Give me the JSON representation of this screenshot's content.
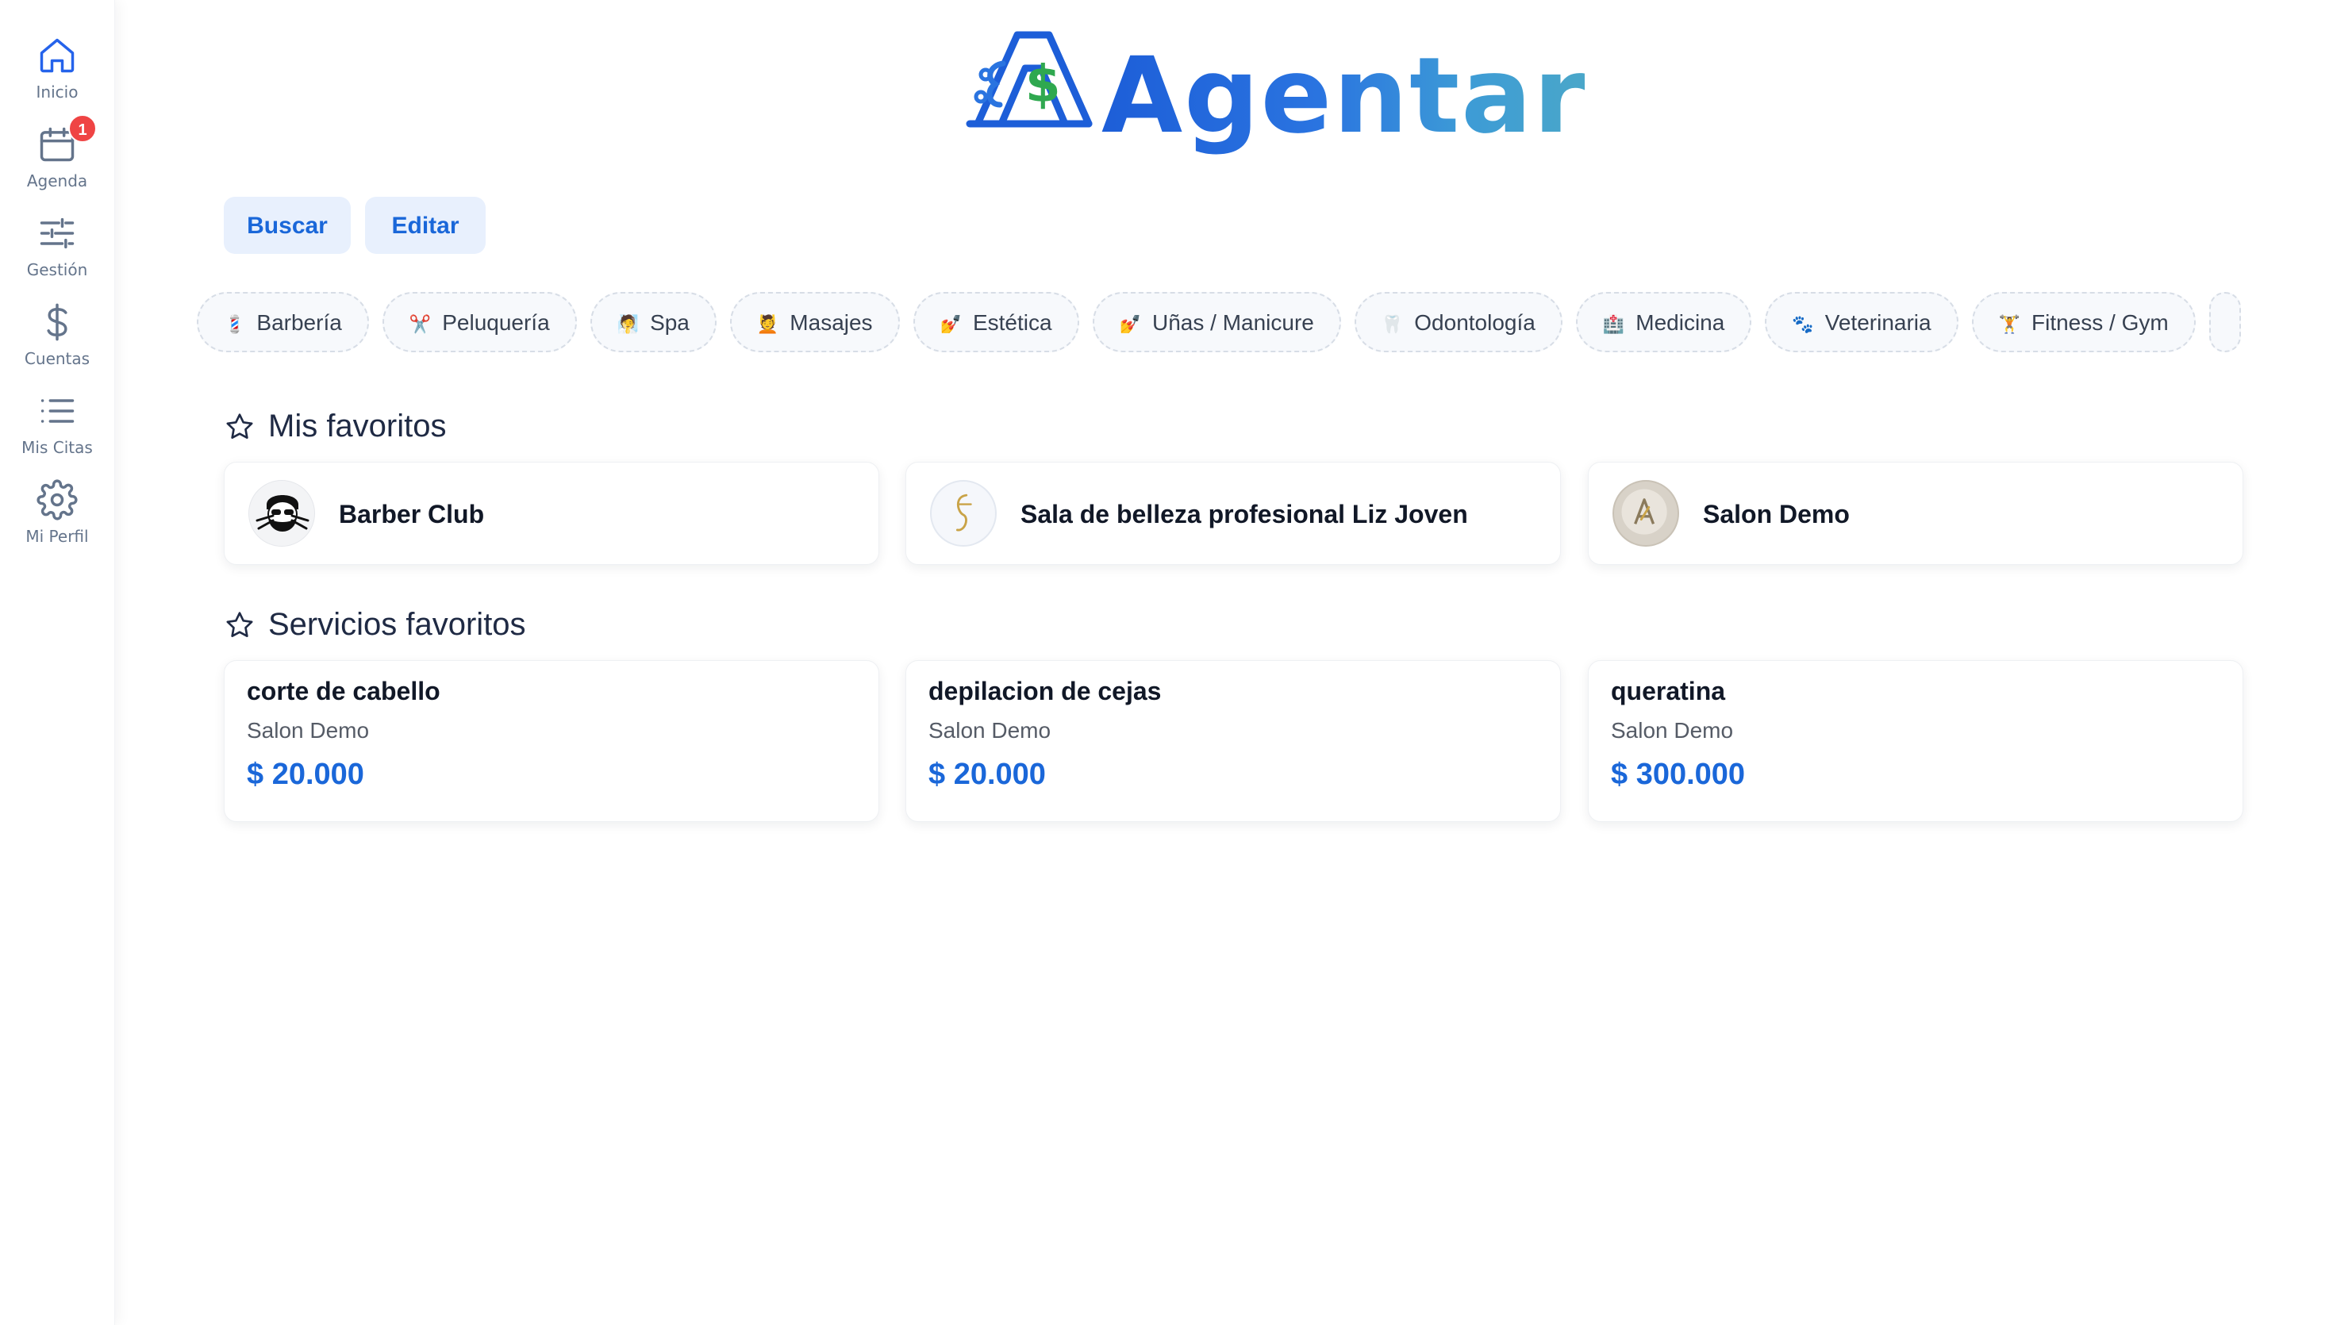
{
  "sidebar": {
    "items": [
      {
        "label": "Inicio",
        "icon": "home-icon"
      },
      {
        "label": "Agenda",
        "icon": "calendar-icon",
        "badge": "1"
      },
      {
        "label": "Gestión",
        "icon": "sliders-icon"
      },
      {
        "label": "Cuentas",
        "icon": "dollar-icon"
      },
      {
        "label": "Mis Citas",
        "icon": "list-icon"
      },
      {
        "label": "Mi Perfil",
        "icon": "gear-icon"
      }
    ],
    "active_color": "#2563eb",
    "icon_color": "#64748b"
  },
  "logo": {
    "text": "Agentar"
  },
  "actions": {
    "search_label": "Buscar",
    "edit_label": "Editar"
  },
  "categories": [
    {
      "emoji": "💈",
      "label": "Barbería"
    },
    {
      "emoji": "✂️",
      "label": "Peluquería"
    },
    {
      "emoji": "🧖",
      "label": "Spa"
    },
    {
      "emoji": "💆",
      "label": "Masajes"
    },
    {
      "emoji": "💅",
      "label": "Estética"
    },
    {
      "emoji": "💅",
      "label": "Uñas / Manicure"
    },
    {
      "emoji": "🦷",
      "label": "Odontología"
    },
    {
      "emoji": "🏥",
      "label": "Medicina"
    },
    {
      "emoji": "🐾",
      "label": "Veterinaria"
    },
    {
      "emoji": "🏋️",
      "label": "Fitness / Gym"
    }
  ],
  "favorites": {
    "title": "Mis favoritos",
    "items": [
      {
        "name": "Barber Club"
      },
      {
        "name": "Sala de belleza profesional Liz Joven"
      },
      {
        "name": "Salon Demo"
      }
    ]
  },
  "favorite_services": {
    "title": "Servicios favoritos",
    "items": [
      {
        "name": "corte de cabello",
        "business": "Salon Demo",
        "price": "$ 20.000"
      },
      {
        "name": "depilacion de cejas",
        "business": "Salon Demo",
        "price": "$ 20.000"
      },
      {
        "name": "queratina",
        "business": "Salon Demo",
        "price": "$ 300.000"
      }
    ]
  },
  "colors": {
    "accent": "#1a67d9",
    "button_bg": "#e8f0fd",
    "badge": "#ef4444"
  }
}
